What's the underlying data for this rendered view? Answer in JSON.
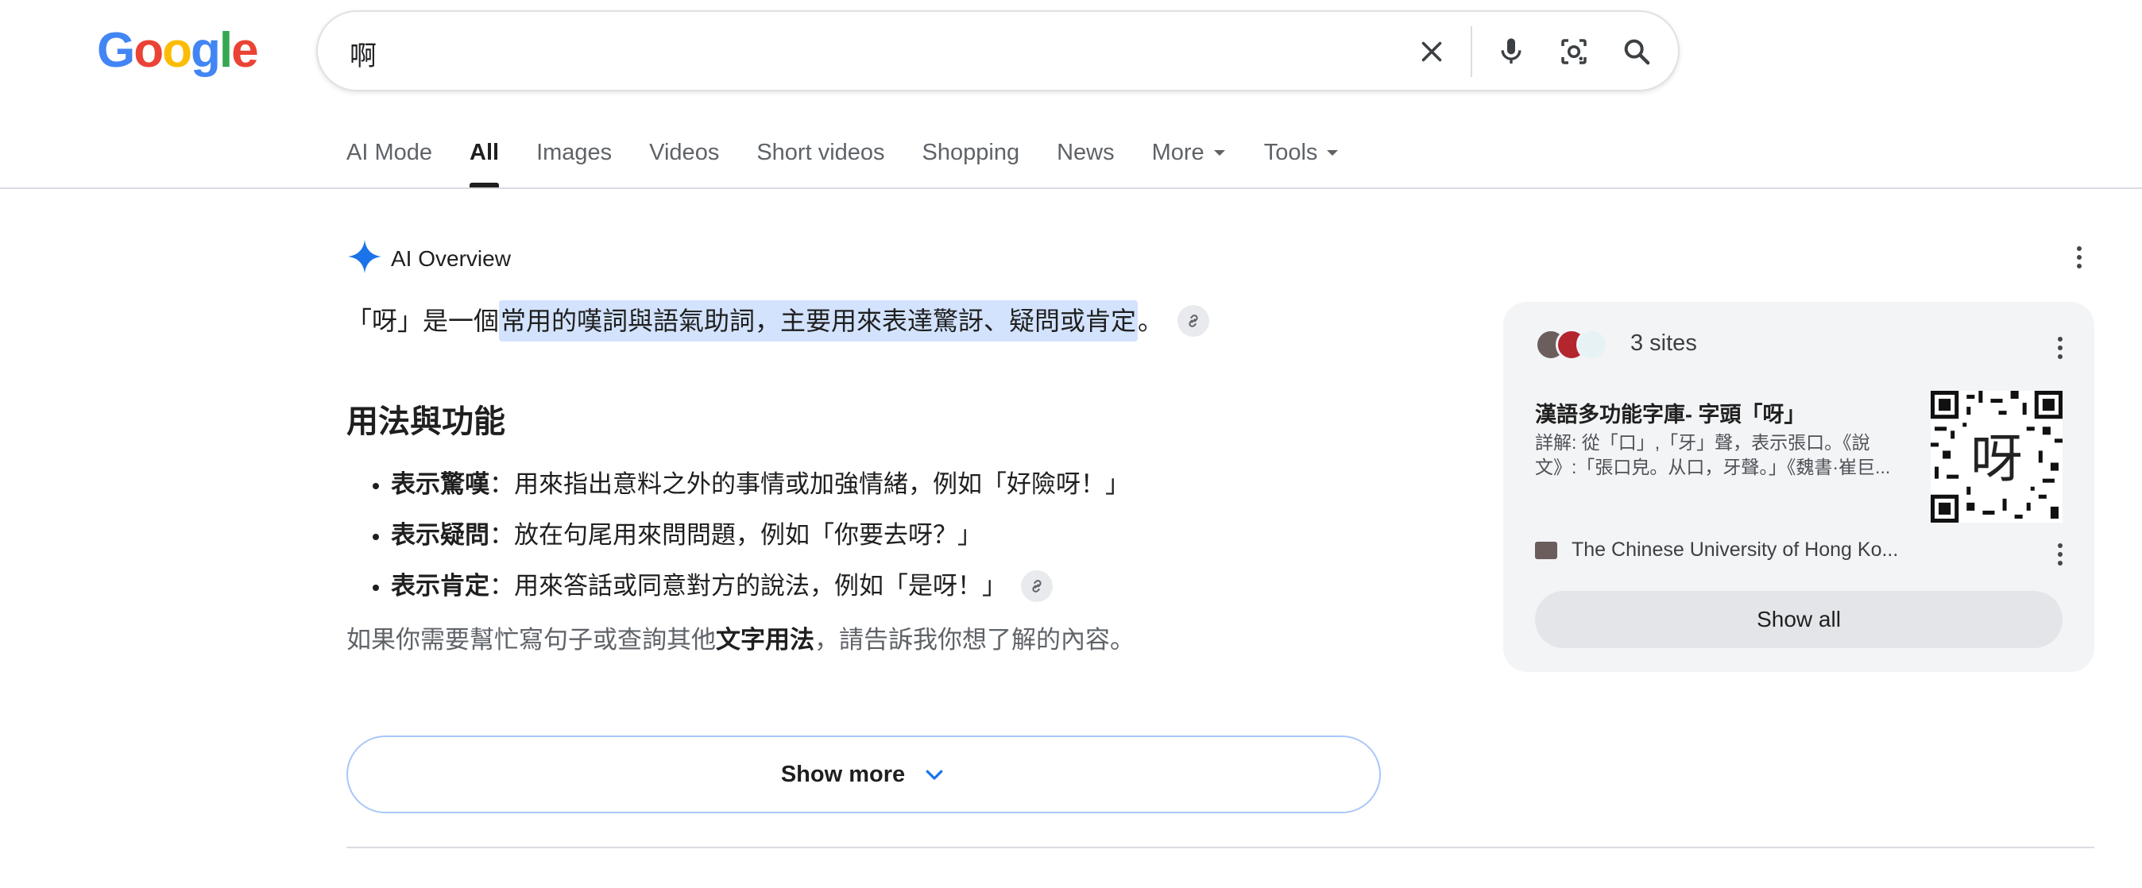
{
  "header": {
    "logo_letters": [
      "G",
      "o",
      "o",
      "g",
      "l",
      "e"
    ],
    "logo_colors": [
      "#4285F4",
      "#EA4335",
      "#FBBC05",
      "#4285F4",
      "#34A853",
      "#EA4335"
    ],
    "search_value": "啊",
    "icons": [
      "close-icon",
      "microphone-icon",
      "camera-lens-icon",
      "search-icon"
    ]
  },
  "tabs": [
    {
      "label": "AI Mode"
    },
    {
      "label": "All",
      "active": true
    },
    {
      "label": "Images"
    },
    {
      "label": "Videos"
    },
    {
      "label": "Short videos"
    },
    {
      "label": "Shopping"
    },
    {
      "label": "News"
    },
    {
      "label": "More"
    },
    {
      "label": "Tools"
    }
  ],
  "ai_overview": {
    "title": "AI Overview",
    "intro_before": "「呀」是一個",
    "intro_highlight": "常用的嘆詞與語氣助詞，主要用來表達驚訝、疑問或肯定",
    "intro_after": "。",
    "heading": "用法與功能",
    "bullets": [
      {
        "term": "表示驚嘆",
        "text": "：用來指出意料之外的事情或加強情緒，例如「好險呀！」"
      },
      {
        "term": "表示疑問",
        "text": "：放在句尾用來問問題，例如「你要去呀？」"
      },
      {
        "term": "表示肯定",
        "text": "：用來答話或同意對方的說法，例如「是呀！」"
      }
    ],
    "closing_before": "如果你需要幫忙寫句子或查詢其他",
    "closing_bold": "文字用法",
    "closing_after": "，請告訴我你想了解的內容。",
    "show_more_label": "Show more",
    "accent_color": "#1a73e8",
    "highlight_color": "#d3e3fd"
  },
  "sources": {
    "count_label": "3 sites",
    "item": {
      "title": "漢語多功能字庫- 字頭「呀」",
      "snippet_line1": "詳解: 從「口」,「牙」聲，表示張口。《說",
      "snippet_line2": "文》:「張口皃。从口，牙聲。」《魏書·崔巨...",
      "site": "The Chinese University of Hong Ko...",
      "thumbnail_char": "呀"
    },
    "show_all_label": "Show all"
  }
}
